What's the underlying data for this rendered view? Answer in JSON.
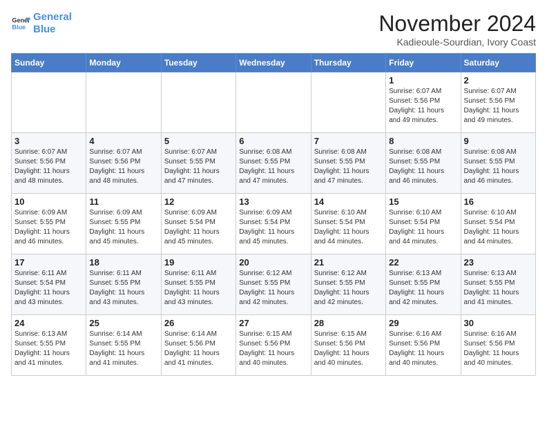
{
  "header": {
    "logo_line1": "General",
    "logo_line2": "Blue",
    "month_title": "November 2024",
    "location": "Kadieoule-Sourdian, Ivory Coast"
  },
  "weekdays": [
    "Sunday",
    "Monday",
    "Tuesday",
    "Wednesday",
    "Thursday",
    "Friday",
    "Saturday"
  ],
  "weeks": [
    [
      {
        "day": "",
        "text": ""
      },
      {
        "day": "",
        "text": ""
      },
      {
        "day": "",
        "text": ""
      },
      {
        "day": "",
        "text": ""
      },
      {
        "day": "",
        "text": ""
      },
      {
        "day": "1",
        "text": "Sunrise: 6:07 AM\nSunset: 5:56 PM\nDaylight: 11 hours\nand 49 minutes."
      },
      {
        "day": "2",
        "text": "Sunrise: 6:07 AM\nSunset: 5:56 PM\nDaylight: 11 hours\nand 49 minutes."
      }
    ],
    [
      {
        "day": "3",
        "text": "Sunrise: 6:07 AM\nSunset: 5:56 PM\nDaylight: 11 hours\nand 48 minutes."
      },
      {
        "day": "4",
        "text": "Sunrise: 6:07 AM\nSunset: 5:56 PM\nDaylight: 11 hours\nand 48 minutes."
      },
      {
        "day": "5",
        "text": "Sunrise: 6:07 AM\nSunset: 5:55 PM\nDaylight: 11 hours\nand 47 minutes."
      },
      {
        "day": "6",
        "text": "Sunrise: 6:08 AM\nSunset: 5:55 PM\nDaylight: 11 hours\nand 47 minutes."
      },
      {
        "day": "7",
        "text": "Sunrise: 6:08 AM\nSunset: 5:55 PM\nDaylight: 11 hours\nand 47 minutes."
      },
      {
        "day": "8",
        "text": "Sunrise: 6:08 AM\nSunset: 5:55 PM\nDaylight: 11 hours\nand 46 minutes."
      },
      {
        "day": "9",
        "text": "Sunrise: 6:08 AM\nSunset: 5:55 PM\nDaylight: 11 hours\nand 46 minutes."
      }
    ],
    [
      {
        "day": "10",
        "text": "Sunrise: 6:09 AM\nSunset: 5:55 PM\nDaylight: 11 hours\nand 46 minutes."
      },
      {
        "day": "11",
        "text": "Sunrise: 6:09 AM\nSunset: 5:55 PM\nDaylight: 11 hours\nand 45 minutes."
      },
      {
        "day": "12",
        "text": "Sunrise: 6:09 AM\nSunset: 5:54 PM\nDaylight: 11 hours\nand 45 minutes."
      },
      {
        "day": "13",
        "text": "Sunrise: 6:09 AM\nSunset: 5:54 PM\nDaylight: 11 hours\nand 45 minutes."
      },
      {
        "day": "14",
        "text": "Sunrise: 6:10 AM\nSunset: 5:54 PM\nDaylight: 11 hours\nand 44 minutes."
      },
      {
        "day": "15",
        "text": "Sunrise: 6:10 AM\nSunset: 5:54 PM\nDaylight: 11 hours\nand 44 minutes."
      },
      {
        "day": "16",
        "text": "Sunrise: 6:10 AM\nSunset: 5:54 PM\nDaylight: 11 hours\nand 44 minutes."
      }
    ],
    [
      {
        "day": "17",
        "text": "Sunrise: 6:11 AM\nSunset: 5:54 PM\nDaylight: 11 hours\nand 43 minutes."
      },
      {
        "day": "18",
        "text": "Sunrise: 6:11 AM\nSunset: 5:55 PM\nDaylight: 11 hours\nand 43 minutes."
      },
      {
        "day": "19",
        "text": "Sunrise: 6:11 AM\nSunset: 5:55 PM\nDaylight: 11 hours\nand 43 minutes."
      },
      {
        "day": "20",
        "text": "Sunrise: 6:12 AM\nSunset: 5:55 PM\nDaylight: 11 hours\nand 42 minutes."
      },
      {
        "day": "21",
        "text": "Sunrise: 6:12 AM\nSunset: 5:55 PM\nDaylight: 11 hours\nand 42 minutes."
      },
      {
        "day": "22",
        "text": "Sunrise: 6:13 AM\nSunset: 5:55 PM\nDaylight: 11 hours\nand 42 minutes."
      },
      {
        "day": "23",
        "text": "Sunrise: 6:13 AM\nSunset: 5:55 PM\nDaylight: 11 hours\nand 41 minutes."
      }
    ],
    [
      {
        "day": "24",
        "text": "Sunrise: 6:13 AM\nSunset: 5:55 PM\nDaylight: 11 hours\nand 41 minutes."
      },
      {
        "day": "25",
        "text": "Sunrise: 6:14 AM\nSunset: 5:55 PM\nDaylight: 11 hours\nand 41 minutes."
      },
      {
        "day": "26",
        "text": "Sunrise: 6:14 AM\nSunset: 5:56 PM\nDaylight: 11 hours\nand 41 minutes."
      },
      {
        "day": "27",
        "text": "Sunrise: 6:15 AM\nSunset: 5:56 PM\nDaylight: 11 hours\nand 40 minutes."
      },
      {
        "day": "28",
        "text": "Sunrise: 6:15 AM\nSunset: 5:56 PM\nDaylight: 11 hours\nand 40 minutes."
      },
      {
        "day": "29",
        "text": "Sunrise: 6:16 AM\nSunset: 5:56 PM\nDaylight: 11 hours\nand 40 minutes."
      },
      {
        "day": "30",
        "text": "Sunrise: 6:16 AM\nSunset: 5:56 PM\nDaylight: 11 hours\nand 40 minutes."
      }
    ]
  ]
}
